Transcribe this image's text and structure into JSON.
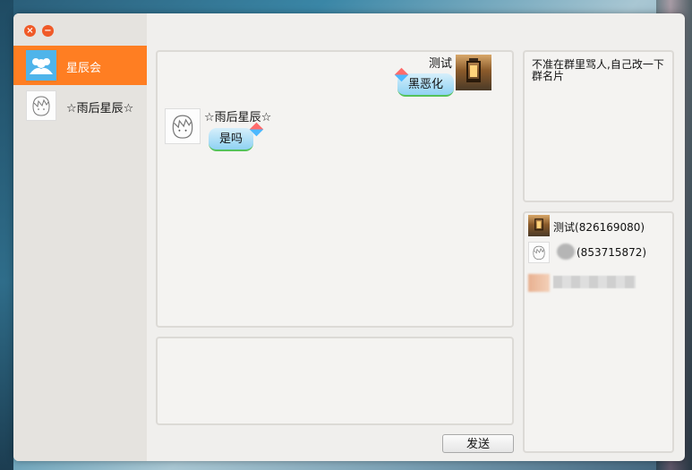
{
  "window": {
    "close_glyph": "×",
    "minimize_glyph": "−"
  },
  "sessions": [
    {
      "label": "星辰会",
      "avatar_icon": "group-icon",
      "active": true
    },
    {
      "label": "☆雨后星辰☆",
      "avatar_icon": "sketch-avatar-icon",
      "active": false
    }
  ],
  "chat": {
    "messages": [
      {
        "sender": "测试",
        "text": "黑恶化",
        "side": "right",
        "avatar_icon": "lamp-avatar-icon"
      },
      {
        "sender": "☆雨后星辰☆",
        "text": "是吗",
        "side": "left",
        "avatar_icon": "sketch-avatar-icon"
      }
    ]
  },
  "input": {
    "value": ""
  },
  "send_button": {
    "label": "发送"
  },
  "notice": {
    "text": "不准在群里骂人,自己改一下群名片"
  },
  "members": [
    {
      "name": "测试",
      "qq": "(826169080)",
      "avatar_icon": "lamp-avatar-icon"
    },
    {
      "name": "",
      "qq": "(853715872)",
      "avatar_icon": "sketch-avatar-icon",
      "name_obscured": true
    },
    {
      "name": "",
      "qq": "",
      "avatar_icon": "obscured-avatar-icon",
      "name_obscured": true
    }
  ],
  "colors": {
    "accent": "#ff7e22",
    "window_control": "#f05a28",
    "bubble_top": "#d6effb",
    "bubble_bottom": "#8fd2f3",
    "bubble_underline": "#55c25a"
  }
}
